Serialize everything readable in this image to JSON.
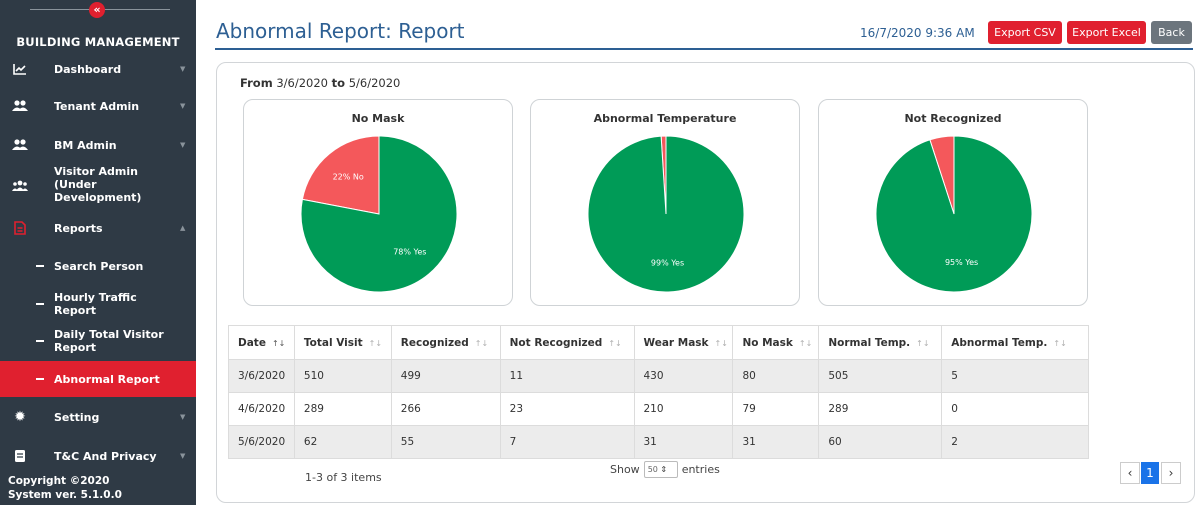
{
  "sidebar": {
    "title": "BUILDING MANAGEMENT",
    "items": [
      {
        "label": "Dashboard"
      },
      {
        "label": "Tenant Admin"
      },
      {
        "label": "BM Admin"
      },
      {
        "label": "Visitor Admin\n(Under\nDevelopment)"
      },
      {
        "label": "Reports"
      },
      {
        "label": "Setting"
      },
      {
        "label": "T&C And Privacy"
      }
    ],
    "sub_items": [
      {
        "label": "Search Person"
      },
      {
        "label": "Hourly Traffic\nReport"
      },
      {
        "label": "Daily Total Visitor\nReport"
      },
      {
        "label": "Abnormal Report"
      }
    ],
    "footer": "Copyright ©2020\nSystem ver. 5.1.0.0"
  },
  "header": {
    "title": "Abnormal Report: Report",
    "datetime": "16/7/2020 9:36 AM",
    "buttons": {
      "csv": "Export CSV",
      "excel": "Export Excel",
      "back": "Back"
    }
  },
  "range": {
    "from_label": "From",
    "from": "3/6/2020",
    "to_label": "to",
    "to": "5/6/2020"
  },
  "chart_data": [
    {
      "type": "pie",
      "title": "No Mask",
      "slices": [
        {
          "label": "22% No",
          "value": 22,
          "color": "#f4585b"
        },
        {
          "label": "78% Yes",
          "value": 78,
          "color": "#009b57"
        }
      ]
    },
    {
      "type": "pie",
      "title": "Abnormal Temperature",
      "slices": [
        {
          "label": "",
          "value": 1,
          "color": "#f4585b"
        },
        {
          "label": "99% Yes",
          "value": 99,
          "color": "#009b57"
        }
      ]
    },
    {
      "type": "pie",
      "title": "Not Recognized",
      "slices": [
        {
          "label": "",
          "value": 5,
          "color": "#f4585b"
        },
        {
          "label": "95% Yes",
          "value": 95,
          "color": "#009b57"
        }
      ]
    }
  ],
  "table": {
    "columns": [
      "Date",
      "Total Visit",
      "Recognized",
      "Not Recognized",
      "Wear Mask",
      "No Mask",
      "Normal Temp.",
      "Abnormal Temp."
    ],
    "rows": [
      [
        "3/6/2020",
        "510",
        "499",
        "11",
        "430",
        "80",
        "505",
        "5"
      ],
      [
        "4/6/2020",
        "289",
        "266",
        "23",
        "210",
        "79",
        "289",
        "0"
      ],
      [
        "5/6/2020",
        "62",
        "55",
        "7",
        "31",
        "31",
        "60",
        "2"
      ]
    ]
  },
  "pagination": {
    "summary": "1-3 of 3 items",
    "show": "Show",
    "entries": "entries",
    "page_size": "50",
    "current_page": "1",
    "prev": "‹",
    "next": "›"
  }
}
